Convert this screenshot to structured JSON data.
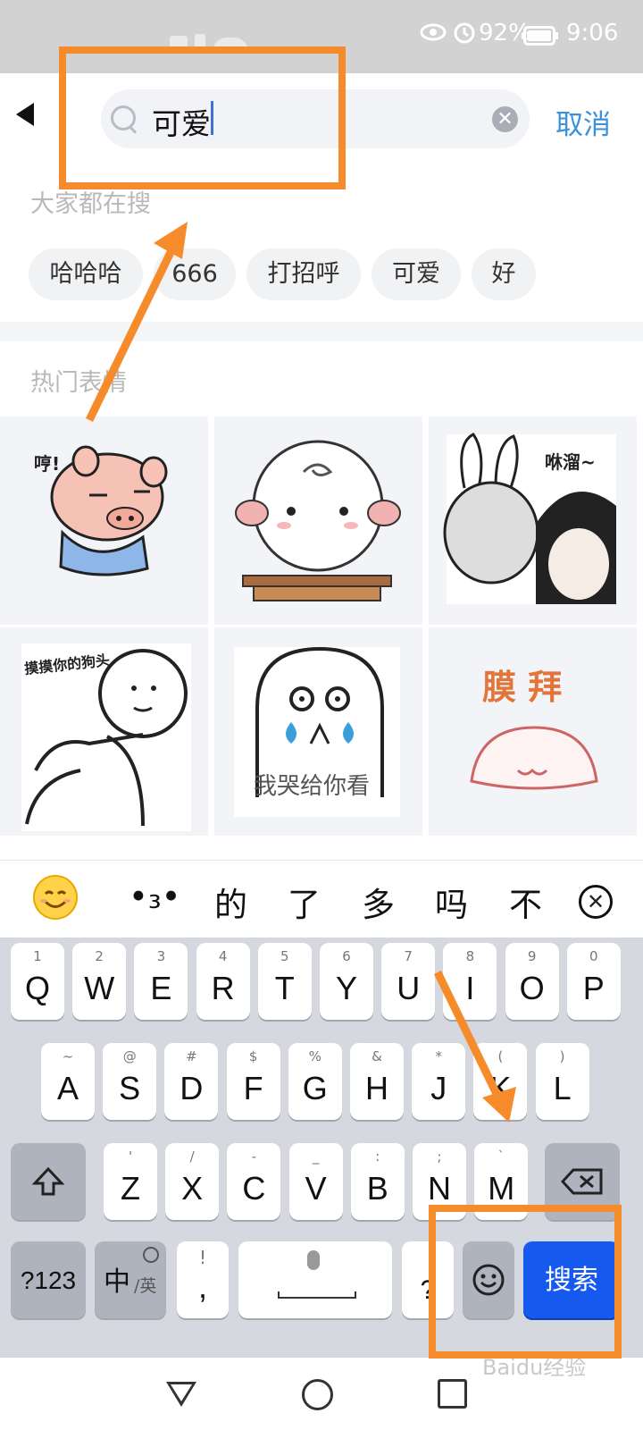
{
  "status_bar": {
    "battery": "92%",
    "time": "9:06"
  },
  "search": {
    "query": "可爱",
    "cancel_label": "取消"
  },
  "hot_search": {
    "title": "大家都在搜",
    "chips": [
      "哈哈哈",
      "666",
      "打招呼",
      "可爱",
      "好"
    ]
  },
  "hot_stickers": {
    "title": "热门表情",
    "captions": [
      "哼!",
      "咻溜~",
      "摸摸你的狗头",
      "我哭给你看",
      "膜 拜"
    ]
  },
  "candidates": {
    "items": [
      "•₃•",
      "的",
      "了",
      "多",
      "吗",
      "不"
    ]
  },
  "keyboard": {
    "row1": [
      {
        "k": "Q",
        "s": "1"
      },
      {
        "k": "W",
        "s": "2"
      },
      {
        "k": "E",
        "s": "3"
      },
      {
        "k": "R",
        "s": "4"
      },
      {
        "k": "T",
        "s": "5"
      },
      {
        "k": "Y",
        "s": "6"
      },
      {
        "k": "U",
        "s": "7"
      },
      {
        "k": "I",
        "s": "8"
      },
      {
        "k": "O",
        "s": "9"
      },
      {
        "k": "P",
        "s": "0"
      }
    ],
    "row2": [
      {
        "k": "A",
        "s": "~"
      },
      {
        "k": "S",
        "s": "@"
      },
      {
        "k": "D",
        "s": "#"
      },
      {
        "k": "F",
        "s": "$"
      },
      {
        "k": "G",
        "s": "%"
      },
      {
        "k": "H",
        "s": "&"
      },
      {
        "k": "J",
        "s": "*"
      },
      {
        "k": "K",
        "s": "("
      },
      {
        "k": "L",
        "s": ")"
      }
    ],
    "row3": [
      {
        "k": "Z",
        "s": "'"
      },
      {
        "k": "X",
        "s": "/"
      },
      {
        "k": "C",
        "s": "-"
      },
      {
        "k": "V",
        "s": "_"
      },
      {
        "k": "B",
        "s": ":"
      },
      {
        "k": "N",
        "s": ";"
      },
      {
        "k": "M",
        "s": "`"
      }
    ],
    "num_label": "?123",
    "lang_label": "中",
    "lang_sub": "/英",
    "punct_sub": "!",
    "punct_main": ",",
    "search_label": "搜索"
  },
  "watermark": "Baidu经验"
}
